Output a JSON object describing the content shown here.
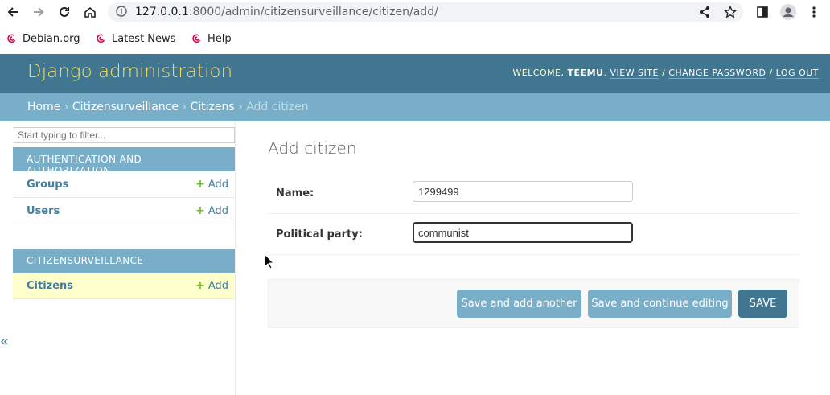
{
  "browser": {
    "url_host": "127.0.0.1",
    "url_rest": ":8000/admin/citizensurveillance/citizen/add/",
    "bookmarks": [
      {
        "label": "Debian.org"
      },
      {
        "label": "Latest News"
      },
      {
        "label": "Help"
      }
    ]
  },
  "header": {
    "branding": "Django administration",
    "welcome": "Welcome,",
    "username": "Teemu",
    "view_site": "View site",
    "change_password": "Change password",
    "log_out": "Log out",
    "sep": "/"
  },
  "breadcrumbs": {
    "items": [
      "Home",
      "Citizensurveillance",
      "Citizens"
    ],
    "current": "Add citizen",
    "sep": "›"
  },
  "sidebar": {
    "filter_placeholder": "Start typing to filter...",
    "apps": [
      {
        "caption": "Authentication and Authorization",
        "models": [
          {
            "name": "Groups",
            "add": "Add"
          },
          {
            "name": "Users",
            "add": "Add"
          }
        ]
      },
      {
        "caption": "Citizensurveillance",
        "models": [
          {
            "name": "Citizens",
            "add": "Add"
          }
        ]
      }
    ],
    "collapse": "«"
  },
  "main": {
    "title": "Add citizen",
    "fields": [
      {
        "label": "Name:",
        "value": "1299499"
      },
      {
        "label": "Political party:",
        "value": "communist"
      }
    ],
    "buttons": {
      "save_add_another": "Save and add another",
      "save_continue": "Save and continue editing",
      "save": "SAVE"
    }
  },
  "colors": {
    "header_bg": "#417690",
    "breadcrumb_bg": "#79aec8",
    "branding": "#f5dd5d",
    "current_model_bg": "#ffffcc",
    "add_plus": "#70bf2b"
  }
}
